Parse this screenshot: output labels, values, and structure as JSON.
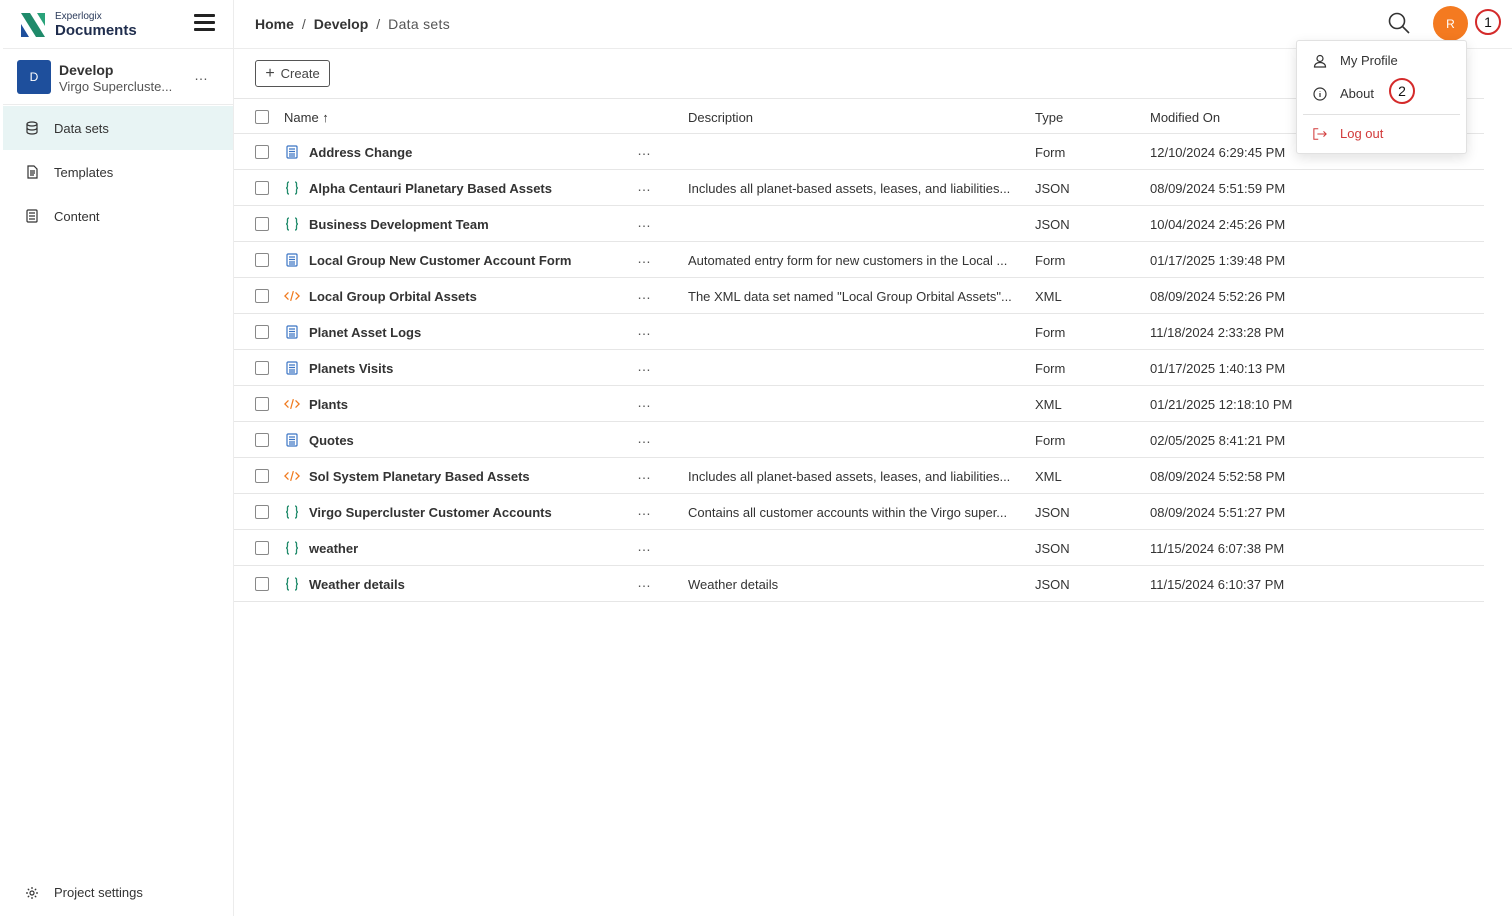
{
  "brand": {
    "small": "Experlogix",
    "big": "Documents"
  },
  "project": {
    "initial": "D",
    "name": "Develop",
    "subtitle": "Virgo Supercluste...",
    "more": "…"
  },
  "nav": {
    "items": [
      {
        "label": "Data sets",
        "icon": "database-icon"
      },
      {
        "label": "Templates",
        "icon": "document-icon"
      },
      {
        "label": "Content",
        "icon": "content-icon"
      }
    ],
    "settings": "Project settings"
  },
  "breadcrumb": {
    "home": "Home",
    "sep1": "/",
    "develop": "Develop",
    "sep2": "/",
    "current": "Data sets"
  },
  "user": {
    "initial": "R"
  },
  "markers": {
    "one": "1",
    "two": "2"
  },
  "toolbar": {
    "create": "Create",
    "create_icon": "+"
  },
  "table": {
    "columns": {
      "name": "Name ↑",
      "description": "Description",
      "type": "Type",
      "modified": "Modified On"
    },
    "more_label": "…",
    "rows": [
      {
        "name": "Address Change",
        "description": "",
        "type": "Form",
        "modified": "12/10/2024 6:29:45 PM",
        "icon": "form"
      },
      {
        "name": "Alpha Centauri Planetary Based Assets",
        "description": "Includes all planet-based assets, leases, and liabilities...",
        "type": "JSON",
        "modified": "08/09/2024 5:51:59 PM",
        "icon": "json"
      },
      {
        "name": "Business Development Team",
        "description": "",
        "type": "JSON",
        "modified": "10/04/2024 2:45:26 PM",
        "icon": "json"
      },
      {
        "name": "Local Group New Customer Account Form",
        "description": "Automated entry form for new customers in the Local ...",
        "type": "Form",
        "modified": "01/17/2025 1:39:48 PM",
        "icon": "form"
      },
      {
        "name": "Local Group Orbital Assets",
        "description": "The XML data set named \"Local Group Orbital Assets\"...",
        "type": "XML",
        "modified": "08/09/2024 5:52:26 PM",
        "icon": "xml"
      },
      {
        "name": "Planet Asset Logs",
        "description": "",
        "type": "Form",
        "modified": "11/18/2024 2:33:28 PM",
        "icon": "form"
      },
      {
        "name": "Planets Visits",
        "description": "",
        "type": "Form",
        "modified": "01/17/2025 1:40:13 PM",
        "icon": "form"
      },
      {
        "name": "Plants",
        "description": "",
        "type": "XML",
        "modified": "01/21/2025 12:18:10 PM",
        "icon": "xml"
      },
      {
        "name": "Quotes",
        "description": "",
        "type": "Form",
        "modified": "02/05/2025 8:41:21 PM",
        "icon": "form"
      },
      {
        "name": "Sol System Planetary Based Assets",
        "description": "Includes all planet-based assets, leases, and liabilities...",
        "type": "XML",
        "modified": "08/09/2024 5:52:58 PM",
        "icon": "xml"
      },
      {
        "name": "Virgo Supercluster Customer Accounts",
        "description": "Contains all customer accounts within the Virgo super...",
        "type": "JSON",
        "modified": "08/09/2024 5:51:27 PM",
        "icon": "json"
      },
      {
        "name": "weather",
        "description": "",
        "type": "JSON",
        "modified": "11/15/2024 6:07:38 PM",
        "icon": "json"
      },
      {
        "name": "Weather details",
        "description": "Weather details",
        "type": "JSON",
        "modified": "11/15/2024 6:10:37 PM",
        "icon": "json"
      }
    ]
  },
  "dropdown": {
    "profile": "My Profile",
    "about": "About",
    "logout": "Log out"
  },
  "colors": {
    "accent": "#e8f4f4",
    "user_avatar": "#f47a20",
    "project_avatar": "#1e4f9c",
    "json_icon": "#1f8a6a",
    "form_icon": "#3b74c4",
    "xml_icon": "#f07a1e",
    "logout": "#d23a3a"
  }
}
